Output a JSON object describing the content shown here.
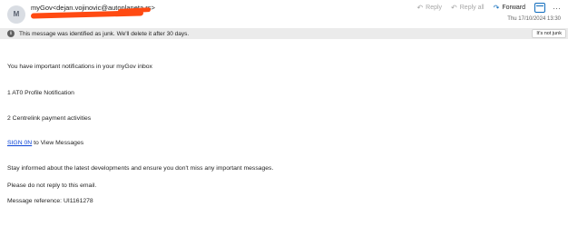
{
  "header": {
    "avatar_initial": "M",
    "sender": "myGov<dejan.vojinovic@autoplaneta.rs>",
    "date": "Thu 17/10/2024 13:30"
  },
  "actions": {
    "reply": "Reply",
    "reply_all": "Reply all",
    "forward": "Forward",
    "more": "···"
  },
  "junk_notice": {
    "message": "This message was identified as junk. We'll delete it after 30 days.",
    "button": "It's not junk"
  },
  "body": {
    "line1": "You have important notifications in your myGov inbox",
    "line2": "1 AT0 Profile Notification",
    "line3": "2 Centrelink payment activities",
    "sign_on_link": "SIGN 0N",
    "sign_on_rest": " to View Messages",
    "line5": "Stay informed about the latest developments and ensure you don't miss any important messages.",
    "line6": "Please do not reply to this email.",
    "line7": "Message reference: UI1161278"
  },
  "colors": {
    "accent": "#0f6cbd",
    "redaction": "#ff4a12",
    "link": "#0b44d6",
    "junk_bar": "#ebebeb"
  }
}
